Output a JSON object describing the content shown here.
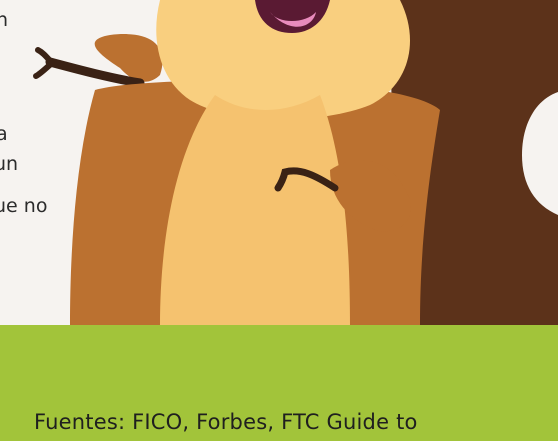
{
  "left_text": {
    "line_1": "n",
    "line_2": "a",
    "line_3": "un",
    "line_4": "ue no"
  },
  "footer": {
    "sources": "Fuentes: FICO, Forbes, FTC Guide to"
  },
  "colors": {
    "background": "#f6f3f0",
    "fur_light": "#f9cf7f",
    "fur_dark": "#bb7130",
    "tree_brown": "#5c321a",
    "mouth": "#5a1a33",
    "tongue": "#e98bbd",
    "hand": "#3a2215",
    "band_green": "#a2c43a",
    "footer_text": "#1f1f1f"
  }
}
